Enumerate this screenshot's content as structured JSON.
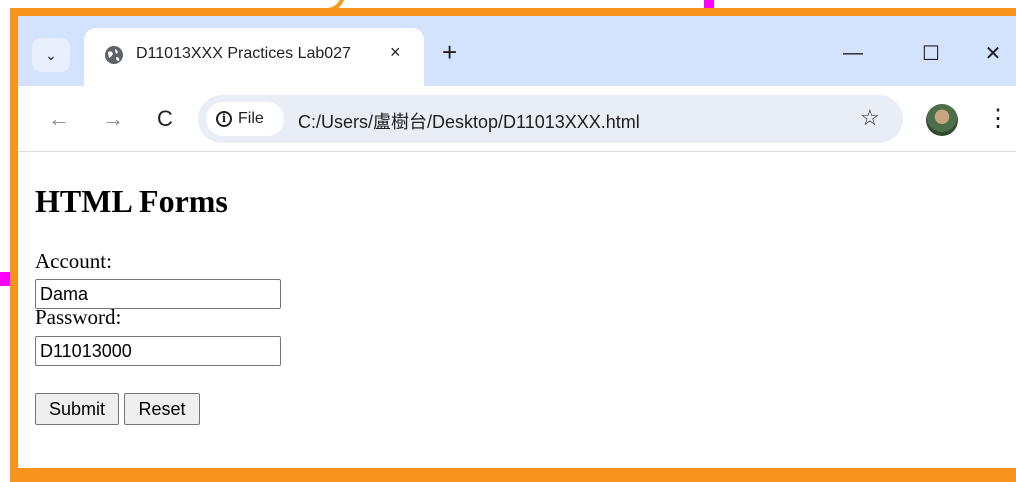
{
  "browser": {
    "tab": {
      "title": "D11013XXX Practices Lab027",
      "close": "×"
    },
    "new_tab": "+",
    "window_controls": {
      "minimize": "—",
      "maximize": "☐",
      "close": "✕"
    },
    "nav": {
      "back": "←",
      "forward": "→",
      "reload": "C"
    },
    "address_bar": {
      "site_chip": "File",
      "url": "C:/Users/盧樹台/Desktop/D11013XXX.html"
    },
    "bookmark_icon": "☆",
    "menu_icon": "⋮",
    "tab_search_icon": "⌄"
  },
  "page": {
    "heading": "HTML Forms",
    "form": {
      "account_label": "Account:",
      "account_value": "Dama",
      "password_label": "Password:",
      "password_value": "D11013000",
      "submit_label": "Submit",
      "reset_label": "Reset"
    }
  },
  "colors": {
    "frame": "#f7941d",
    "tabstrip": "#d3e3fd",
    "omnibox": "#e9eef6",
    "marker": "#ff00ff"
  }
}
